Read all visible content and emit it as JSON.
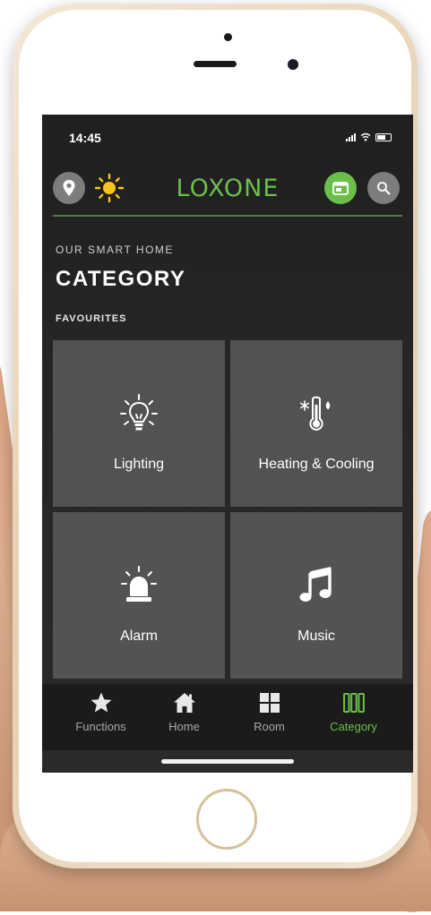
{
  "status": {
    "time": "14:45"
  },
  "header": {
    "brand": "LOXONE"
  },
  "page": {
    "eyebrow": "OUR SMART HOME",
    "title": "CATEGORY",
    "section": "FAVOURITES"
  },
  "tiles": [
    {
      "label": "Lighting",
      "icon": "lightbulb-icon"
    },
    {
      "label": "Heating & Cooling",
      "icon": "thermometer-icon"
    },
    {
      "label": "Alarm",
      "icon": "alarm-siren-icon"
    },
    {
      "label": "Music",
      "icon": "music-note-icon"
    }
  ],
  "tabs": [
    {
      "label": "Functions",
      "icon": "star-icon"
    },
    {
      "label": "Home",
      "icon": "house-icon"
    },
    {
      "label": "Room",
      "icon": "grid-icon"
    },
    {
      "label": "Category",
      "icon": "category-bars-icon",
      "active": true
    }
  ],
  "colors": {
    "accent": "#6abf4b",
    "screen_bg": "#232323",
    "tile_bg": "#5e5e5e"
  }
}
